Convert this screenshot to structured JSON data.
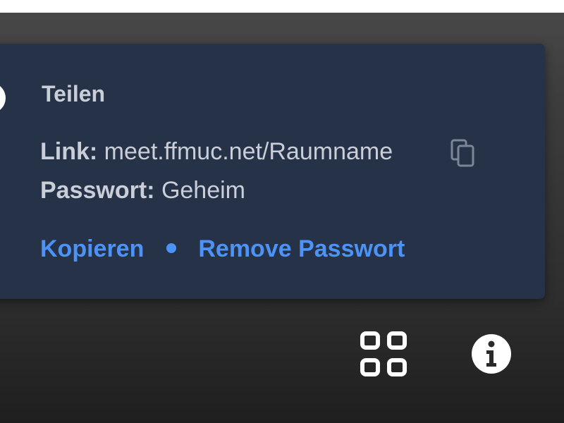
{
  "share_popup": {
    "title": "Teilen",
    "link_label": "Link:",
    "link_value": "meet.ffmuc.net/Raumname",
    "password_label": "Passwort:",
    "password_value": "Geheim",
    "copy_action": "Kopieren",
    "remove_password_action": "Remove Passwort"
  },
  "icons": {
    "copy": "copy-icon",
    "tile_view": "tile-view-icon",
    "info": "info-icon"
  },
  "colors": {
    "popup_background": "#253248",
    "text": "#c9ced8",
    "accent": "#4d92f5",
    "toolbar_icon": "#ffffff"
  }
}
